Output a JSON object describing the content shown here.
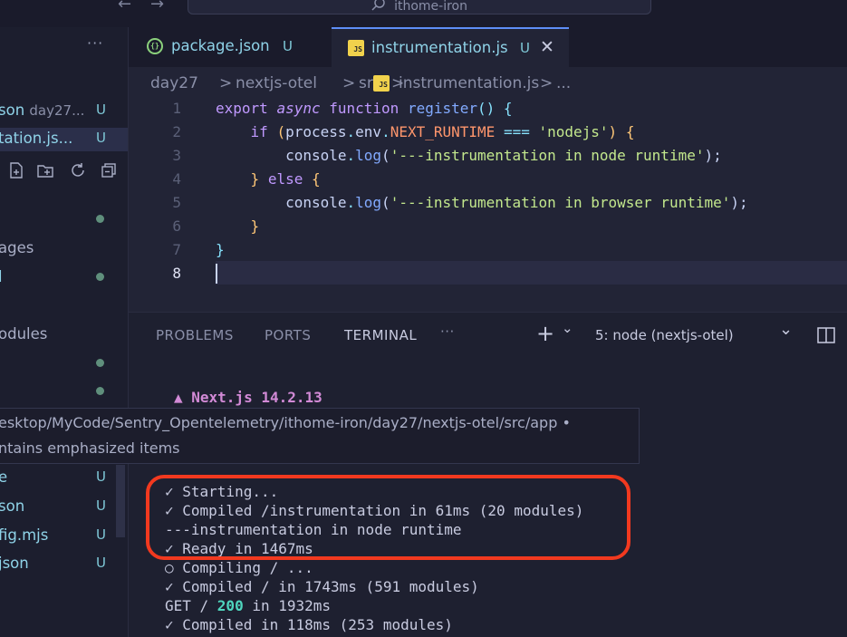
{
  "titlebar": {
    "back_glyph": "←",
    "forward_glyph": "→",
    "search_icon": "search-icon",
    "search_text": "ithome-iron"
  },
  "sidebar": {
    "more_glyph": "···",
    "open_editors": [
      {
        "name": "son",
        "dir": "day27...",
        "status": "U"
      },
      {
        "name": "tation.js...",
        "status": "U"
      }
    ],
    "toolbar_icons": [
      "new-file-icon",
      "new-folder-icon",
      "refresh-icon",
      "collapse-icon"
    ],
    "tree_labels": [
      "ages",
      "l",
      "odules"
    ],
    "files": [
      {
        "name": "e",
        "status": "U"
      },
      {
        "name": "son",
        "status": "U"
      },
      {
        "name": "fig.mjs",
        "status": "U"
      },
      {
        "name": "json",
        "status": "U"
      }
    ]
  },
  "tabs": [
    {
      "label": "package.json",
      "status": "U",
      "icon": "json-file-icon"
    },
    {
      "label": "instrumentation.js",
      "status": "U",
      "icon": "js-file-icon",
      "active": true,
      "close_glyph": "✕"
    }
  ],
  "breadcrumb": {
    "parts": [
      "day27",
      "nextjs-otel",
      "src",
      "instrumentation.js",
      "..."
    ],
    "sep": ">"
  },
  "editor": {
    "line_numbers": [
      "1",
      "2",
      "3",
      "4",
      "5",
      "6",
      "7",
      "8"
    ],
    "code": {
      "export": "export",
      "async": "async",
      "function": "function",
      "register": "register",
      "parens": "()",
      "open_brace": "{",
      "if": "if",
      "paren_open": "(",
      "process": "process",
      "dot": ".",
      "env": "env",
      "next_runtime": "NEXT_RUNTIME",
      "eq": "===",
      "nodejs": "'nodejs'",
      "paren_close": ")",
      "console": "console",
      "log": "log",
      "msg_node": "'---instrumentation in node runtime'",
      "semi": ";",
      "close_brace": "}",
      "else": "else",
      "msg_browser": "'---instrumentation in browser runtime'"
    }
  },
  "panel": {
    "tabs": [
      "PROBLEMS",
      "PORTS",
      "TERMINAL",
      "···"
    ],
    "active_tab": "TERMINAL",
    "plus_glyph": "+",
    "chevron_glyph": "⌄",
    "terminal_select": "5: node (nextjs-otel)",
    "split_icon": "split-panel-icon"
  },
  "terminal": {
    "title": "▲ Next.js 14.2.13",
    "lines": [
      "✓ Starting...",
      "✓ Compiled /instrumentation in 61ms (20 modules)",
      "---instrumentation in node runtime",
      "✓ Ready in 1467ms",
      "○ Compiling / ...",
      "✓ Compiled / in 1743ms (591 modules)"
    ],
    "get_prefix": "GET / ",
    "get_code": "200",
    "get_suffix": " in 1932ms",
    "last_line": "✓ Compiled in 118ms (253 modules)"
  },
  "hover": {
    "path": "esktop/MyCode/Sentry_Opentelemetry/ithome-iron/day27/nextjs-otel/src/app •",
    "note": "ntains emphasized items"
  },
  "colors": {
    "annotation": "#f2391f",
    "tab_active_border": "#5e8ef7",
    "untracked": "#7fc9d8"
  }
}
